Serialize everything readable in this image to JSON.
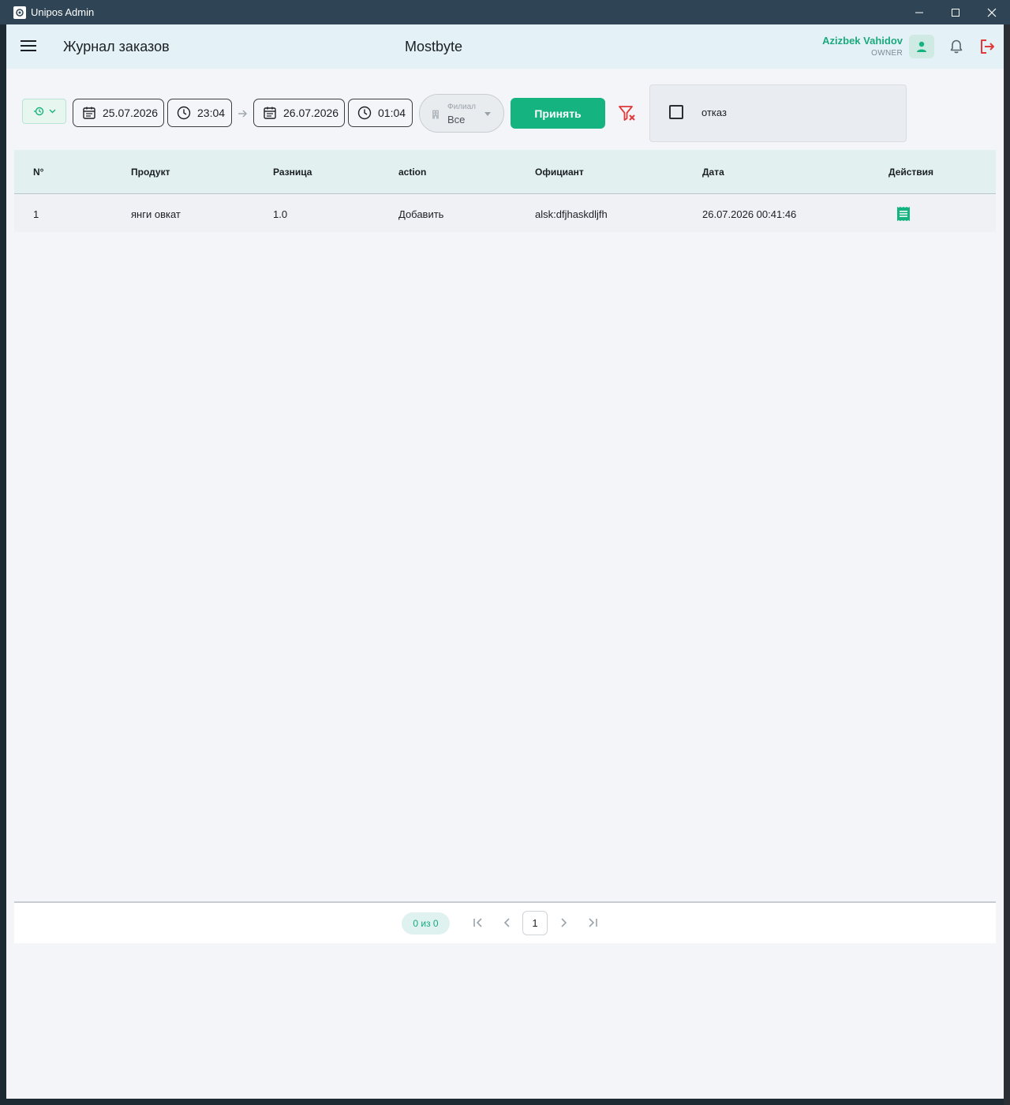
{
  "window": {
    "title": "Unipos Admin"
  },
  "header": {
    "page_title": "Журнал заказов",
    "company": "Mostbyte",
    "user_name": "Azizbek Vahidov",
    "user_role": "OWNER"
  },
  "filters": {
    "date_from": "25.07.2026",
    "time_from": "23:04",
    "date_to": "26.07.2026",
    "time_to": "01:04",
    "branch_label": "Филиал",
    "branch_value": "Все",
    "accept_label": "Принять",
    "reject_label": "отказ",
    "reject_checked": false
  },
  "table": {
    "columns": [
      "N°",
      "Продукт",
      "Разница",
      "action",
      "Официант",
      "Дата",
      "Действия"
    ],
    "rows": [
      {
        "num": "1",
        "product": "янги овкат",
        "diff": "1.0",
        "action": "Добавить",
        "waiter": "alsk:dfjhaskdljfh",
        "date": "26.07.2026 00:41:46"
      }
    ]
  },
  "pagination": {
    "summary": "0 из 0",
    "current_page": "1"
  },
  "colors": {
    "accent": "#14b37f",
    "danger": "#e03a3a",
    "titlebar": "#2f4454",
    "header_bg": "#e4f2f7"
  }
}
